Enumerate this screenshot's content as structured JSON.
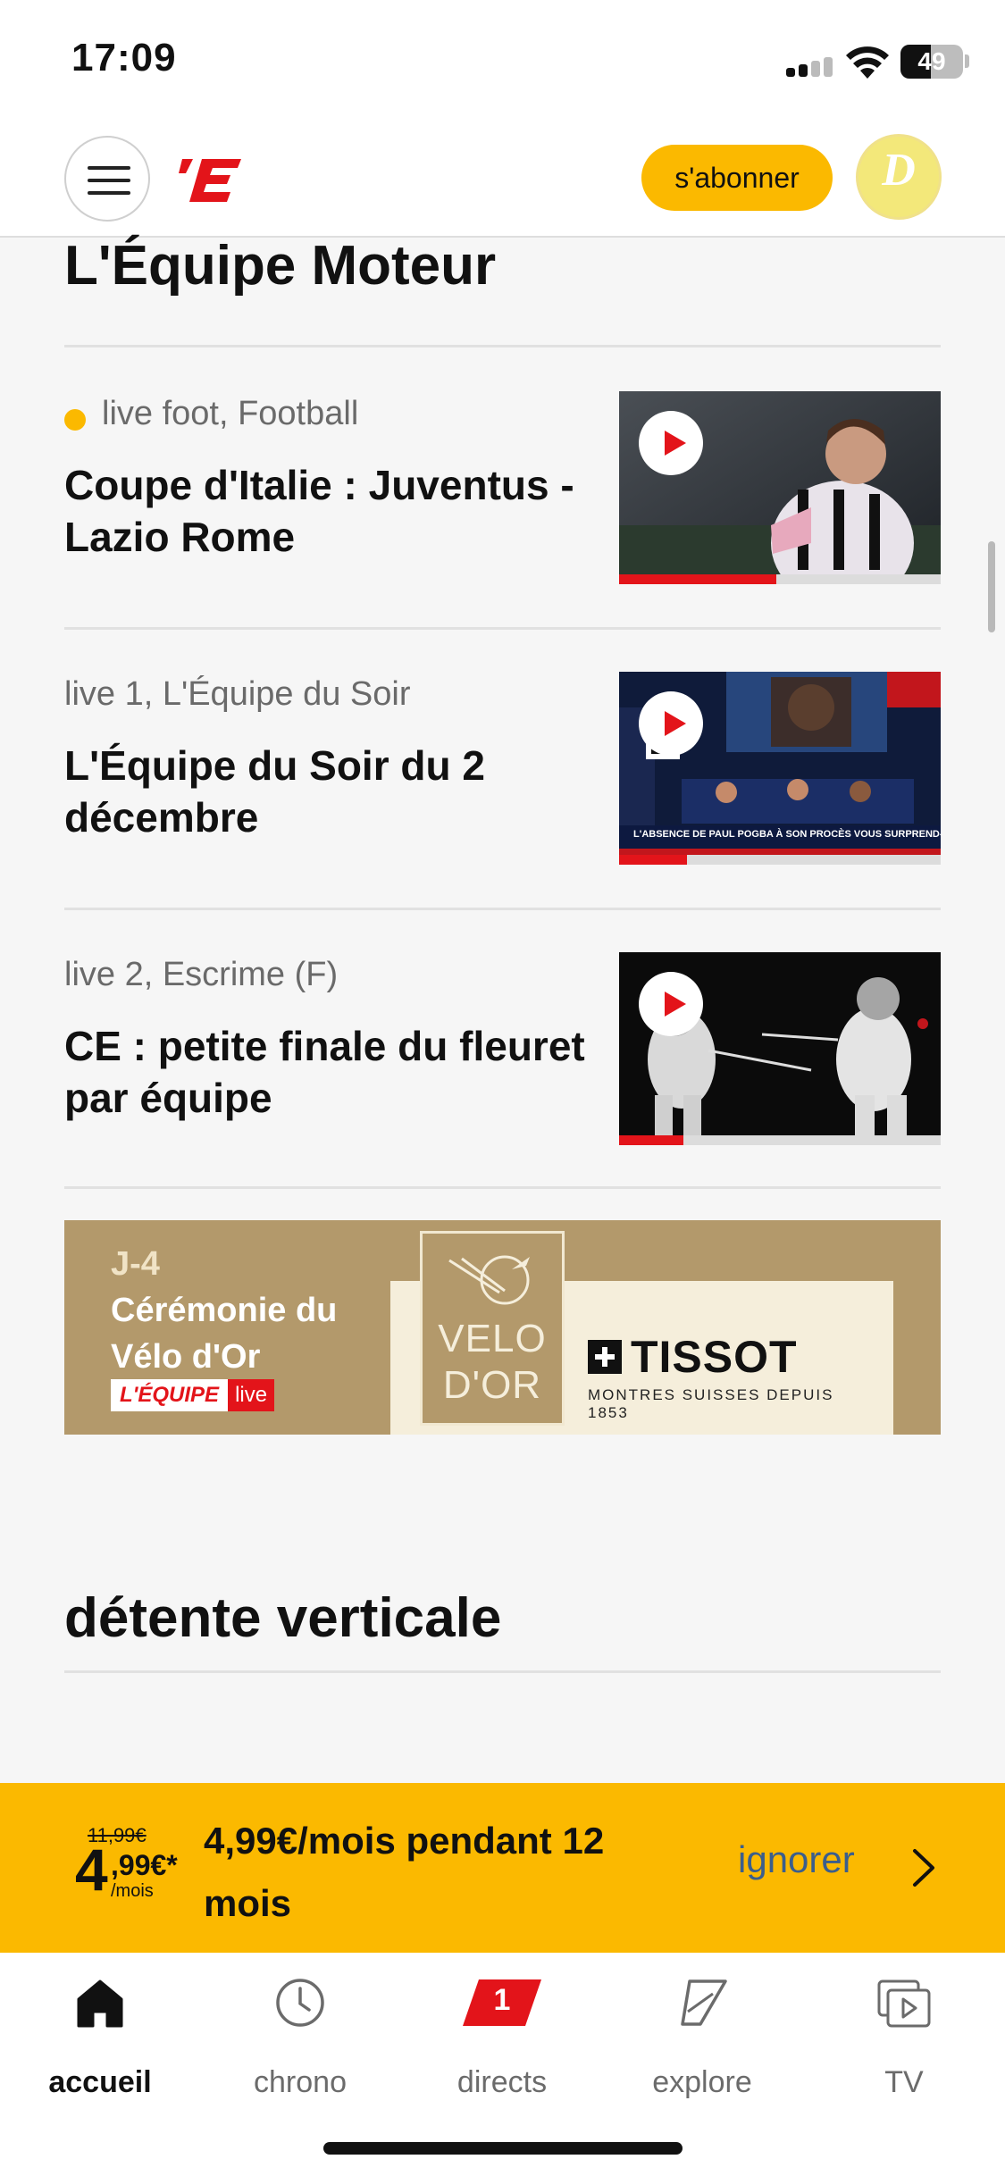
{
  "status_bar": {
    "time": "17:09",
    "battery": "49",
    "battery_level": 0.49
  },
  "header": {
    "menu_icon": "hamburger-menu-icon",
    "logo_text": "’E",
    "subscribe_label": "s'abonner",
    "avatar_initial": "D"
  },
  "sections": {
    "moteur_title": "L'Équipe Moteur",
    "detente_title": "détente verticale"
  },
  "cards": [
    {
      "category": "live foot, Football",
      "live": true,
      "headline": "Coupe d'Italie : Juventus - Lazio Rome",
      "progress": 0.49,
      "thumb_desc": "football-player-thumbnail"
    },
    {
      "category": "live 1, L'Équipe du Soir",
      "live": false,
      "headline": "L'Équipe du Soir du 2 décembre",
      "progress": 0.21,
      "thumb_desc": "tv-studio-thumbnail",
      "thumb_caption": "L'ABSENCE DE PAUL POGBA À SON PROCÈS VOUS SURPREND-ELLE ?"
    },
    {
      "category": "live 2, Escrime (F)",
      "live": false,
      "headline": "CE : petite finale du fleuret par équipe",
      "progress": 0.2,
      "thumb_desc": "fencing-thumbnail"
    }
  ],
  "ad": {
    "countdown": "J-4",
    "event": "Cérémonie du Vélo d'Or",
    "live_brand": "L'ÉQUIPE",
    "live_tag": "live",
    "velo_logo_text": "VELO D'OR",
    "sponsor": "TISSOT",
    "sponsor_tagline": "MONTRES SUISSES DEPUIS 1853"
  },
  "promo": {
    "old_price": "11,99€",
    "price_int": "4",
    "price_cents": ",99€*",
    "price_unit": "/mois",
    "text": "4,99€/mois pendant 12 mois",
    "ignore_label": "ignorer"
  },
  "tabs": [
    {
      "label": "accueil",
      "icon": "home-icon",
      "active": true
    },
    {
      "label": "chrono",
      "icon": "clock-icon",
      "active": false
    },
    {
      "label": "directs",
      "icon": "live-badge-icon",
      "badge": "1",
      "active": false
    },
    {
      "label": "explore",
      "icon": "explore-icon",
      "active": false
    },
    {
      "label": "TV",
      "icon": "tv-play-icon",
      "active": false
    }
  ],
  "colors": {
    "accent": "#fbb900",
    "brand_red": "#e3141a",
    "link_blue": "#3b5e8c"
  }
}
